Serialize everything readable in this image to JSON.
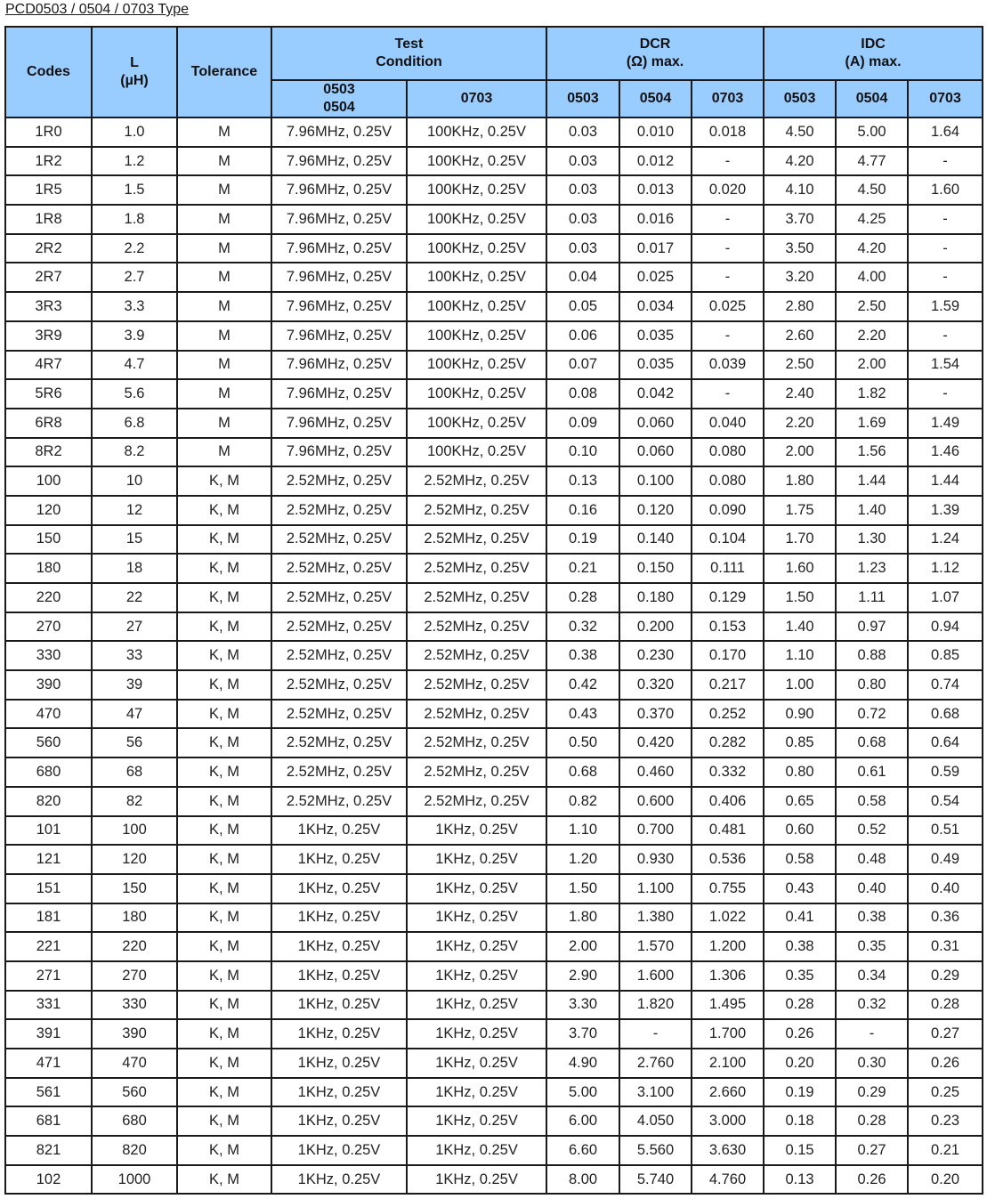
{
  "title": "PCD0503 / 0504 / 0703 Type",
  "headers": {
    "codes": "Codes",
    "l": "L",
    "l_unit": "(µH)",
    "tolerance": "Tolerance",
    "test_condition": [
      "Test",
      "Condition"
    ],
    "dcr": [
      "DCR",
      "(Ω) max."
    ],
    "idc": [
      "IDC",
      "(A) max."
    ],
    "sub": [
      "0503",
      "0504",
      "0703",
      "0503",
      "0504",
      "0703",
      "0503",
      "0504",
      "0703"
    ]
  },
  "rows": [
    [
      "1R0",
      "1.0",
      "M",
      "7.96MHz, 0.25V",
      "100KHz, 0.25V",
      "0.03",
      "0.010",
      "0.018",
      "4.50",
      "5.00",
      "1.64"
    ],
    [
      "1R2",
      "1.2",
      "M",
      "7.96MHz, 0.25V",
      "100KHz, 0.25V",
      "0.03",
      "0.012",
      "-",
      "4.20",
      "4.77",
      "-"
    ],
    [
      "1R5",
      "1.5",
      "M",
      "7.96MHz, 0.25V",
      "100KHz, 0.25V",
      "0.03",
      "0.013",
      "0.020",
      "4.10",
      "4.50",
      "1.60"
    ],
    [
      "1R8",
      "1.8",
      "M",
      "7.96MHz, 0.25V",
      "100KHz, 0.25V",
      "0.03",
      "0.016",
      "-",
      "3.70",
      "4.25",
      "-"
    ],
    [
      "2R2",
      "2.2",
      "M",
      "7.96MHz, 0.25V",
      "100KHz, 0.25V",
      "0.03",
      "0.017",
      "-",
      "3.50",
      "4.20",
      "-"
    ],
    [
      "2R7",
      "2.7",
      "M",
      "7.96MHz, 0.25V",
      "100KHz, 0.25V",
      "0.04",
      "0.025",
      "-",
      "3.20",
      "4.00",
      "-"
    ],
    [
      "3R3",
      "3.3",
      "M",
      "7.96MHz, 0.25V",
      "100KHz, 0.25V",
      "0.05",
      "0.034",
      "0.025",
      "2.80",
      "2.50",
      "1.59"
    ],
    [
      "3R9",
      "3.9",
      "M",
      "7.96MHz, 0.25V",
      "100KHz, 0.25V",
      "0.06",
      "0.035",
      "-",
      "2.60",
      "2.20",
      "-"
    ],
    [
      "4R7",
      "4.7",
      "M",
      "7.96MHz, 0.25V",
      "100KHz, 0.25V",
      "0.07",
      "0.035",
      "0.039",
      "2.50",
      "2.00",
      "1.54"
    ],
    [
      "5R6",
      "5.6",
      "M",
      "7.96MHz, 0.25V",
      "100KHz, 0.25V",
      "0.08",
      "0.042",
      "-",
      "2.40",
      "1.82",
      "-"
    ],
    [
      "6R8",
      "6.8",
      "M",
      "7.96MHz, 0.25V",
      "100KHz, 0.25V",
      "0.09",
      "0.060",
      "0.040",
      "2.20",
      "1.69",
      "1.49"
    ],
    [
      "8R2",
      "8.2",
      "M",
      "7.96MHz, 0.25V",
      "100KHz, 0.25V",
      "0.10",
      "0.060",
      "0.080",
      "2.00",
      "1.56",
      "1.46"
    ],
    [
      "100",
      "10",
      "K, M",
      "2.52MHz, 0.25V",
      "2.52MHz, 0.25V",
      "0.13",
      "0.100",
      "0.080",
      "1.80",
      "1.44",
      "1.44"
    ],
    [
      "120",
      "12",
      "K, M",
      "2.52MHz, 0.25V",
      "2.52MHz, 0.25V",
      "0.16",
      "0.120",
      "0.090",
      "1.75",
      "1.40",
      "1.39"
    ],
    [
      "150",
      "15",
      "K, M",
      "2.52MHz, 0.25V",
      "2.52MHz, 0.25V",
      "0.19",
      "0.140",
      "0.104",
      "1.70",
      "1.30",
      "1.24"
    ],
    [
      "180",
      "18",
      "K, M",
      "2.52MHz, 0.25V",
      "2.52MHz, 0.25V",
      "0.21",
      "0.150",
      "0.111",
      "1.60",
      "1.23",
      "1.12"
    ],
    [
      "220",
      "22",
      "K, M",
      "2.52MHz, 0.25V",
      "2.52MHz, 0.25V",
      "0.28",
      "0.180",
      "0.129",
      "1.50",
      "1.11",
      "1.07"
    ],
    [
      "270",
      "27",
      "K, M",
      "2.52MHz, 0.25V",
      "2.52MHz, 0.25V",
      "0.32",
      "0.200",
      "0.153",
      "1.40",
      "0.97",
      "0.94"
    ],
    [
      "330",
      "33",
      "K, M",
      "2.52MHz, 0.25V",
      "2.52MHz, 0.25V",
      "0.38",
      "0.230",
      "0.170",
      "1.10",
      "0.88",
      "0.85"
    ],
    [
      "390",
      "39",
      "K, M",
      "2.52MHz, 0.25V",
      "2.52MHz, 0.25V",
      "0.42",
      "0.320",
      "0.217",
      "1.00",
      "0.80",
      "0.74"
    ],
    [
      "470",
      "47",
      "K, M",
      "2.52MHz, 0.25V",
      "2.52MHz, 0.25V",
      "0.43",
      "0.370",
      "0.252",
      "0.90",
      "0.72",
      "0.68"
    ],
    [
      "560",
      "56",
      "K, M",
      "2.52MHz, 0.25V",
      "2.52MHz, 0.25V",
      "0.50",
      "0.420",
      "0.282",
      "0.85",
      "0.68",
      "0.64"
    ],
    [
      "680",
      "68",
      "K, M",
      "2.52MHz, 0.25V",
      "2.52MHz, 0.25V",
      "0.68",
      "0.460",
      "0.332",
      "0.80",
      "0.61",
      "0.59"
    ],
    [
      "820",
      "82",
      "K, M",
      "2.52MHz, 0.25V",
      "2.52MHz, 0.25V",
      "0.82",
      "0.600",
      "0.406",
      "0.65",
      "0.58",
      "0.54"
    ],
    [
      "101",
      "100",
      "K, M",
      "1KHz, 0.25V",
      "1KHz, 0.25V",
      "1.10",
      "0.700",
      "0.481",
      "0.60",
      "0.52",
      "0.51"
    ],
    [
      "121",
      "120",
      "K, M",
      "1KHz, 0.25V",
      "1KHz, 0.25V",
      "1.20",
      "0.930",
      "0.536",
      "0.58",
      "0.48",
      "0.49"
    ],
    [
      "151",
      "150",
      "K, M",
      "1KHz, 0.25V",
      "1KHz, 0.25V",
      "1.50",
      "1.100",
      "0.755",
      "0.43",
      "0.40",
      "0.40"
    ],
    [
      "181",
      "180",
      "K, M",
      "1KHz, 0.25V",
      "1KHz, 0.25V",
      "1.80",
      "1.380",
      "1.022",
      "0.41",
      "0.38",
      "0.36"
    ],
    [
      "221",
      "220",
      "K, M",
      "1KHz, 0.25V",
      "1KHz, 0.25V",
      "2.00",
      "1.570",
      "1.200",
      "0.38",
      "0.35",
      "0.31"
    ],
    [
      "271",
      "270",
      "K, M",
      "1KHz, 0.25V",
      "1KHz, 0.25V",
      "2.90",
      "1.600",
      "1.306",
      "0.35",
      "0.34",
      "0.29"
    ],
    [
      "331",
      "330",
      "K, M",
      "1KHz, 0.25V",
      "1KHz, 0.25V",
      "3.30",
      "1.820",
      "1.495",
      "0.28",
      "0.32",
      "0.28"
    ],
    [
      "391",
      "390",
      "K, M",
      "1KHz, 0.25V",
      "1KHz, 0.25V",
      "3.70",
      "-",
      "1.700",
      "0.26",
      "-",
      "0.27"
    ],
    [
      "471",
      "470",
      "K, M",
      "1KHz, 0.25V",
      "1KHz, 0.25V",
      "4.90",
      "2.760",
      "2.100",
      "0.20",
      "0.30",
      "0.26"
    ],
    [
      "561",
      "560",
      "K, M",
      "1KHz, 0.25V",
      "1KHz, 0.25V",
      "5.00",
      "3.100",
      "2.660",
      "0.19",
      "0.29",
      "0.25"
    ],
    [
      "681",
      "680",
      "K, M",
      "1KHz, 0.25V",
      "1KHz, 0.25V",
      "6.00",
      "4.050",
      "3.000",
      "0.18",
      "0.28",
      "0.23"
    ],
    [
      "821",
      "820",
      "K, M",
      "1KHz, 0.25V",
      "1KHz, 0.25V",
      "6.60",
      "5.560",
      "3.630",
      "0.15",
      "0.27",
      "0.21"
    ],
    [
      "102",
      "1000",
      "K, M",
      "1KHz, 0.25V",
      "1KHz, 0.25V",
      "8.00",
      "5.740",
      "4.760",
      "0.13",
      "0.26",
      "0.20"
    ]
  ]
}
